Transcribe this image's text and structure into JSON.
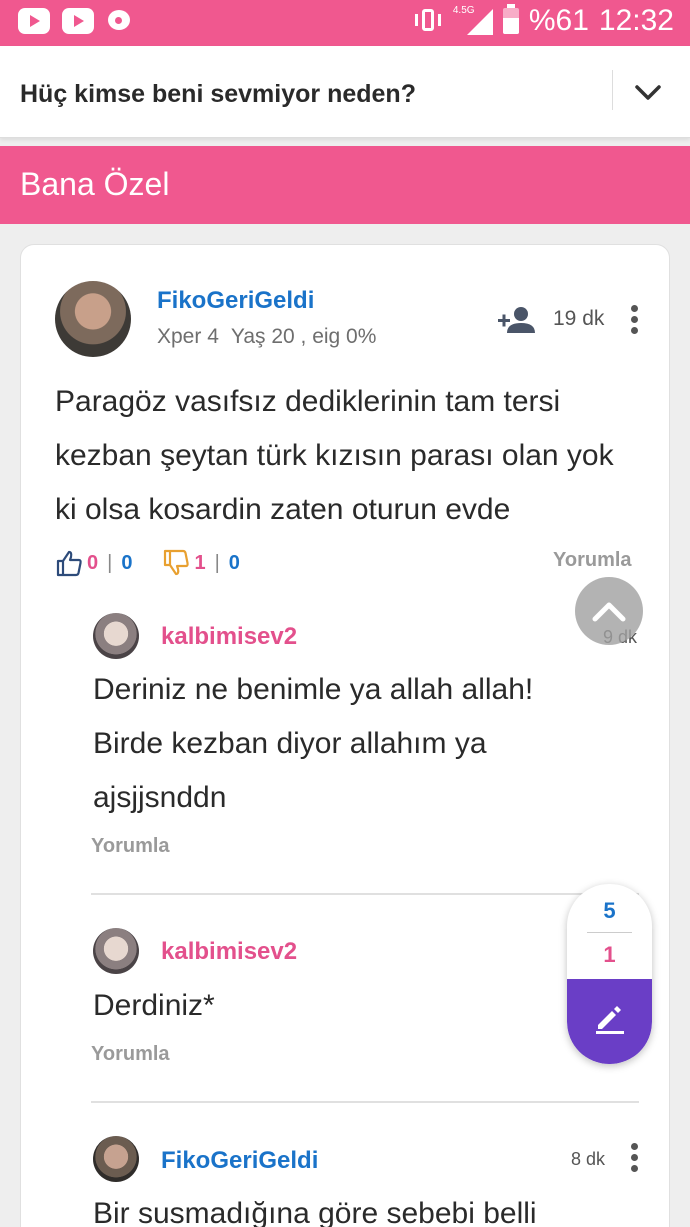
{
  "status_bar": {
    "battery": "%61",
    "network": "4.5G",
    "time": "12:32"
  },
  "header": {
    "title": "Hüç kimse beni sevmiyor neden?"
  },
  "category": {
    "label": "Bana Özel"
  },
  "post": {
    "username": "FikoGeriGeldi",
    "xper": "Xper 4",
    "meta": "Yaş 20 , eig 0%",
    "time": "19 dk",
    "text": "Paragöz vasıfsız dediklerinin tam tersi kezban şeytan türk kızısın parası olan yok ki olsa kosardin zaten oturun evde",
    "likes": "0",
    "likes_sub": "0",
    "dislikes": "1",
    "dislikes_sub": "0",
    "comment_label": "Yorumla"
  },
  "replies": [
    {
      "username": "kalbimisev2",
      "time": "9 dk",
      "text": "Deriniz ne benimle ya allah allah! Birde kezban diyor allahım ya ajsjjsnddn",
      "comment_label": "Yorumla"
    },
    {
      "username": "kalbimisev2",
      "text": "Derdiniz*",
      "comment_label": "Yorumla"
    },
    {
      "username": "FikoGeriGeldi",
      "time": "8 dk",
      "text": "Bir susmadığına göre sebebi belli"
    }
  ],
  "fab": {
    "count_blue": "5",
    "count_pink": "1"
  },
  "colors": {
    "accent": "#f0588f",
    "username_blue": "#1a73c9",
    "username_pink": "#e3508c",
    "fab_purple": "#6a3ec6"
  },
  "icons": [
    "youtube-icon",
    "chat-icon",
    "vibrate-icon",
    "signal-icon",
    "battery-icon",
    "chevron-down-icon",
    "add-user-icon",
    "more-vert-icon",
    "thumb-up-icon",
    "thumb-down-icon",
    "chevron-up-icon",
    "edit-icon"
  ]
}
